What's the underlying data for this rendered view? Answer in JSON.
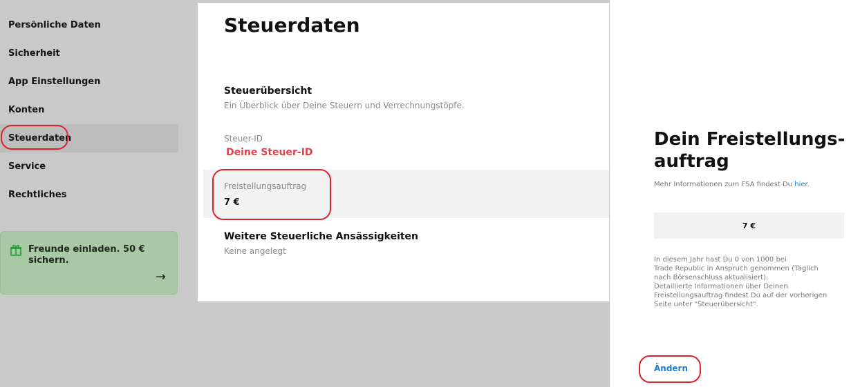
{
  "sidebar": {
    "items": [
      {
        "label": "Persönliche Daten"
      },
      {
        "label": "Sicherheit"
      },
      {
        "label": "App Einstellungen"
      },
      {
        "label": "Konten"
      },
      {
        "label": "Steuerdaten"
      },
      {
        "label": "Service"
      },
      {
        "label": "Rechtliches"
      }
    ],
    "active_index": 4,
    "promo": {
      "label": "Freunde einladen. 50 € sichern.",
      "icon": "gift-icon",
      "arrow": "→"
    }
  },
  "main": {
    "title": "Steuerdaten",
    "overview": {
      "title": "Steuerübersicht",
      "subtitle": "Ein Überblick über Deine Steuern und Verrechnungstöpfe."
    },
    "steuer_id": {
      "label": "Steuer-ID",
      "value": "Deine Steuer-ID"
    },
    "fsa": {
      "label": "Freistellungsauftrag",
      "value": "7 €"
    },
    "residency": {
      "title": "Weitere Steuerliche Ansässigkeiten",
      "subtitle": "Keine angelegt"
    }
  },
  "detail": {
    "heading_line1": "Dein Freistellungs-",
    "heading_line2": "auftrag",
    "info_prefix": "Mehr Informationen zum FSA findest Du ",
    "info_link": "hier",
    "info_suffix": ".",
    "amount": "7 €",
    "desc_lines": [
      "In diesem Jahr hast Du 0 von 1000 bei",
      "Trade Republic in Anspruch genommen (Täglich",
      "nach Börsenschluss aktualisiert).",
      "Detaillierte Informationen über Deinen",
      "Freistellungsauftrag findest Du auf der vorherigen",
      "Seite unter \"Steuerübersicht\"."
    ],
    "change_label": "Ändern"
  },
  "colors": {
    "accent_red": "#e0414c",
    "link_blue": "#1b7fd6",
    "promo_green": "#a9c8a5",
    "annotation_red": "#d8232f"
  }
}
